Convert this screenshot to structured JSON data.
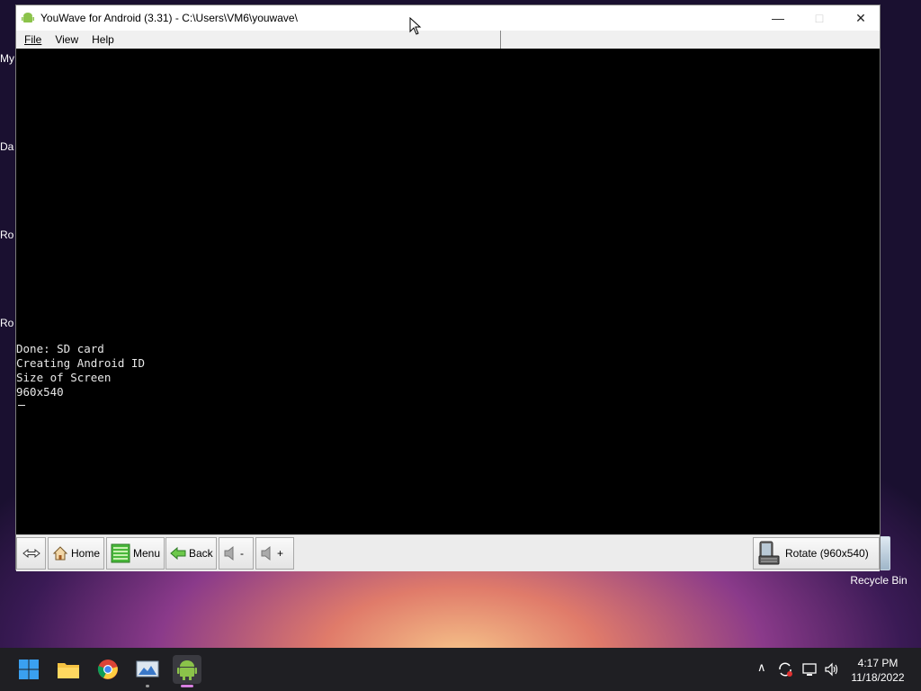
{
  "desktop": {
    "icons": [
      "My",
      "Da",
      "Ro",
      "Ro"
    ],
    "recycle_bin": "Recycle Bin"
  },
  "window": {
    "title": "YouWave for Android (3.31) - C:\\Users\\VM6\\youwave\\",
    "menu": [
      "File",
      "View",
      "Help"
    ],
    "console_lines": [
      "Done: SD card",
      "Creating Android ID",
      "Size of Screen",
      "960x540"
    ],
    "toolbar": {
      "home": "Home",
      "menu": "Menu",
      "back": "Back",
      "vol_down": "-",
      "vol_up": "+",
      "rotate": "Rotate (960x540)"
    }
  },
  "taskbar": {
    "time": "4:17 PM",
    "date": "11/18/2022"
  }
}
